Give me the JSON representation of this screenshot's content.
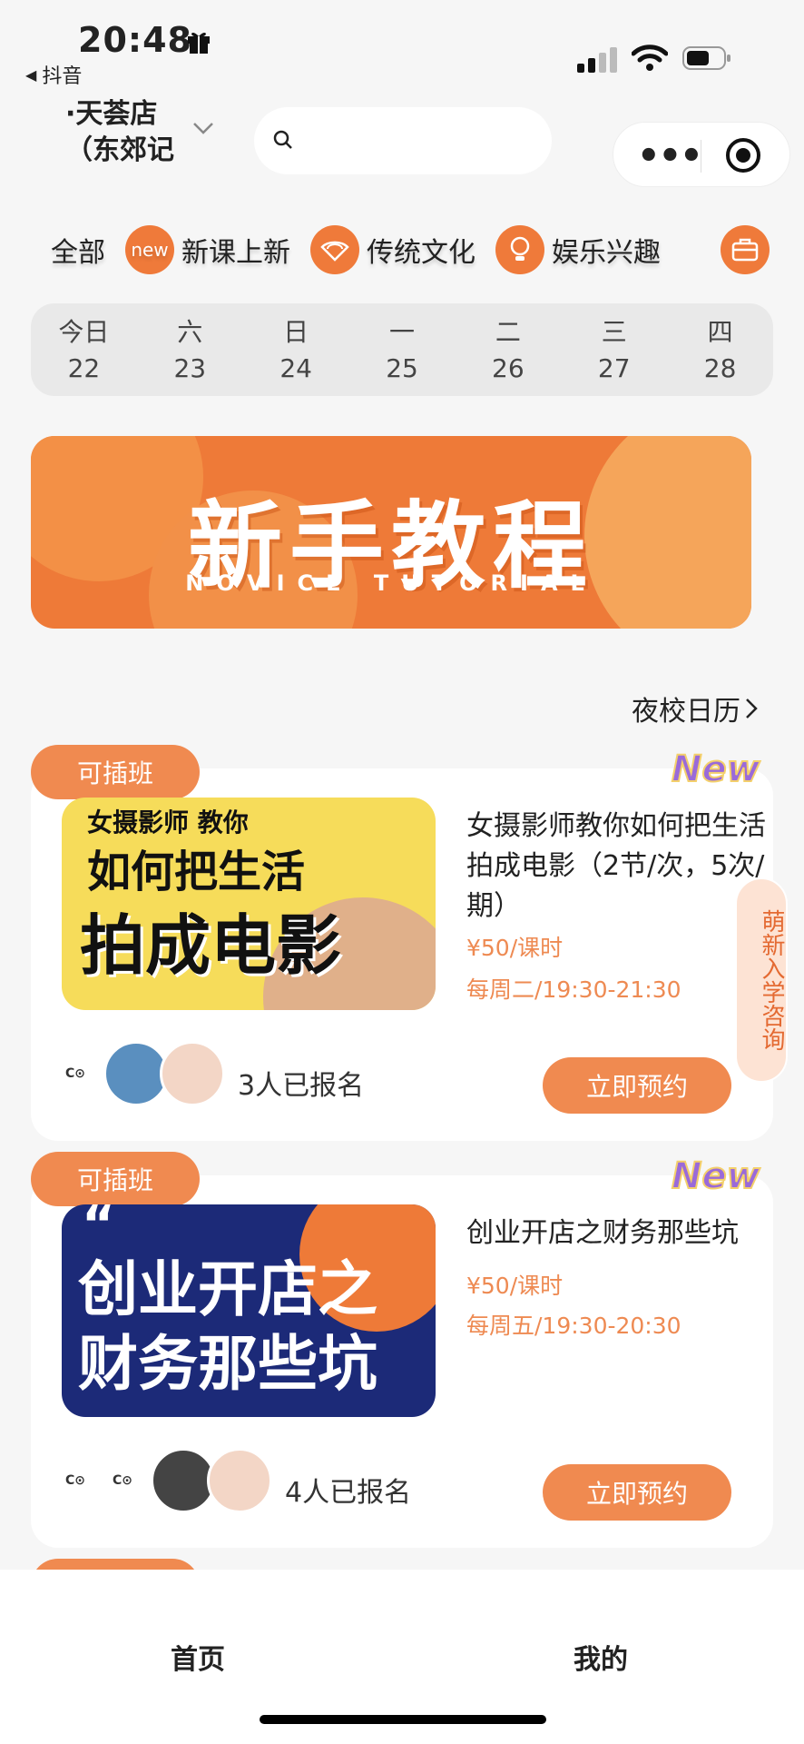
{
  "status_bar": {
    "time": "20:48",
    "back_app": "抖音"
  },
  "header": {
    "store_name": "·天荟店（东郊记"
  },
  "categories": [
    {
      "label": "全部",
      "icon": ""
    },
    {
      "label": "新课上新",
      "icon": "new-icon",
      "icon_text": "new"
    },
    {
      "label": "传统文化",
      "icon": "fan-icon"
    },
    {
      "label": "娱乐兴趣",
      "icon": "bulb-icon"
    }
  ],
  "dates": [
    {
      "weekday": "今日",
      "day": "22"
    },
    {
      "weekday": "六",
      "day": "23"
    },
    {
      "weekday": "日",
      "day": "24"
    },
    {
      "weekday": "一",
      "day": "25"
    },
    {
      "weekday": "二",
      "day": "26"
    },
    {
      "weekday": "三",
      "day": "27"
    },
    {
      "weekday": "四",
      "day": "28"
    }
  ],
  "banner": {
    "title": "新手教程",
    "subtitle": "NOVICE TUTORIAL"
  },
  "calendar_link": "夜校日历",
  "side_tab": "萌新入学咨询",
  "courses": [
    {
      "badge": "可插班",
      "new_tag": "New",
      "thumb_line1": "女摄影师 教你",
      "thumb_line2": "如何把生活",
      "thumb_line3": "拍成电影",
      "title": "女摄影师教你如何把生活拍成电影（2节/次，5次/期）",
      "price": "¥50/课时",
      "schedule": "每周二/19:30-21:30",
      "enrolled": "3人已报名",
      "button": "立即预约"
    },
    {
      "badge": "可插班",
      "new_tag": "New",
      "thumb_line1": "“",
      "thumb_line2": "创业开店之",
      "thumb_line3": "财务那些坑",
      "title": "创业开店之财务那些坑",
      "price": "¥50/课时",
      "schedule": "每周五/19:30-20:30",
      "enrolled": "4人已报名",
      "button": "立即预约"
    }
  ],
  "bottom_nav": {
    "home": "首页",
    "mine": "我的"
  },
  "colors": {
    "accent": "#f08a50",
    "banner": "#ee7a38",
    "price": "#ee8a52"
  }
}
